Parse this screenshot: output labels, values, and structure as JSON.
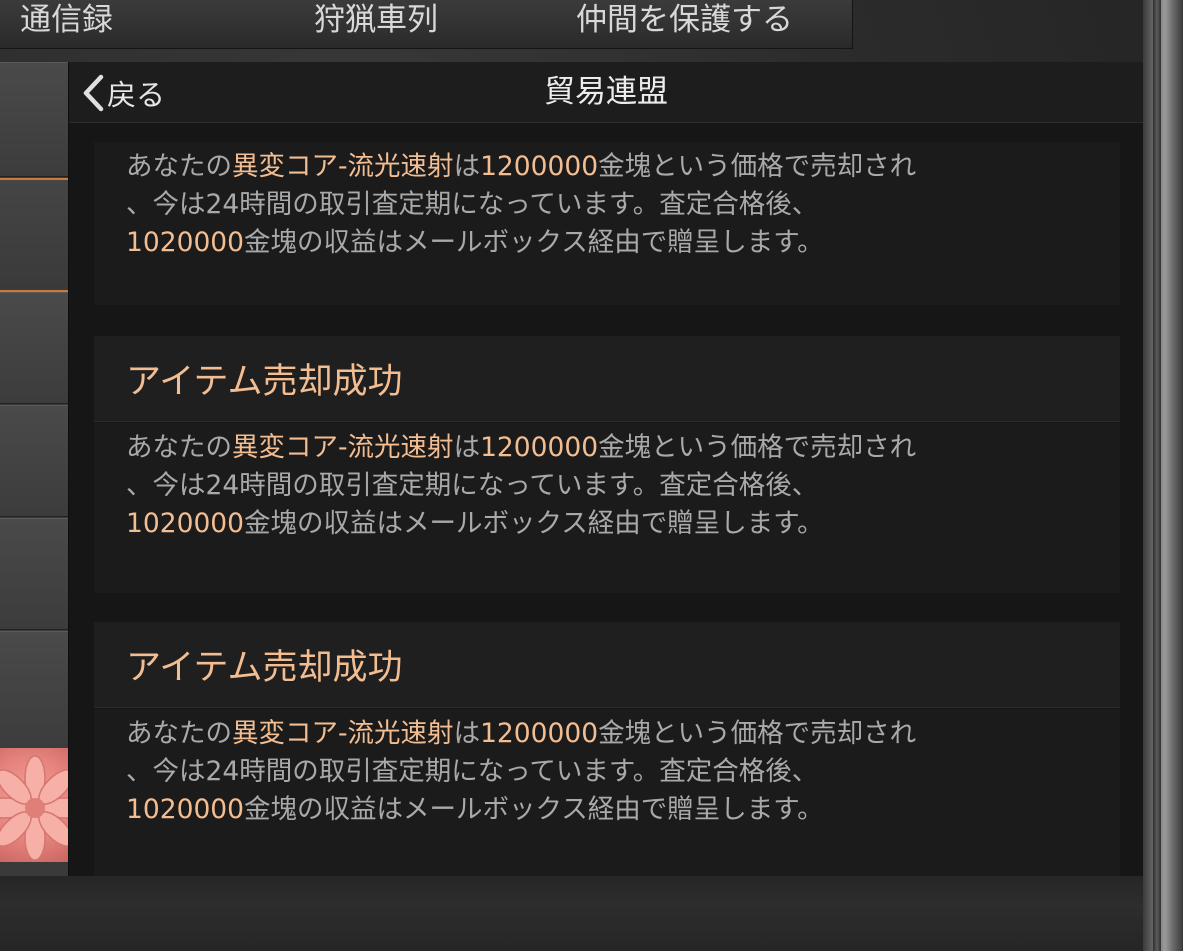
{
  "top_tabs": [
    "通信録",
    "狩猟車列",
    "仲間を保護する"
  ],
  "header": {
    "back_label": "戻る",
    "title": "貿易連盟"
  },
  "messages": [
    {
      "title": "",
      "body": {
        "l1_a": "あなたの",
        "l1_item": "異変コア-流光速射",
        "l1_b": "は",
        "l1_price": "1200000",
        "l1_c": "金塊という価格で売却され",
        "l2": "、今は24時間の取引査定期になっています。査定合格後、",
        "l3_amount": "1020000",
        "l3_rest": "金塊の収益はメールボックス経由で贈呈します。"
      }
    },
    {
      "title": "アイテム売却成功",
      "body": {
        "l1_a": "あなたの",
        "l1_item": "異変コア-流光速射",
        "l1_b": "は",
        "l1_price": "1200000",
        "l1_c": "金塊という価格で売却され",
        "l2": "、今は24時間の取引査定期になっています。査定合格後、",
        "l3_amount": "1020000",
        "l3_rest": "金塊の収益はメールボックス経由で贈呈します。"
      }
    },
    {
      "title": "アイテム売却成功",
      "body": {
        "l1_a": "あなたの",
        "l1_item": "異変コア-流光速射",
        "l1_b": "は",
        "l1_price": "1200000",
        "l1_c": "金塊という価格で売却され",
        "l2": "、今は24時間の取引査定期になっています。査定合格後、",
        "l3_amount": "1020000",
        "l3_rest": "金塊の収益はメールボックス経由で贈呈します。"
      }
    }
  ],
  "colors": {
    "highlight": "#f3bd92",
    "body_text": "#a9a9a9",
    "selected_border": "#c97b3c"
  },
  "icons": {
    "back": "chevron-left-icon",
    "decoration": "flower-icon"
  }
}
